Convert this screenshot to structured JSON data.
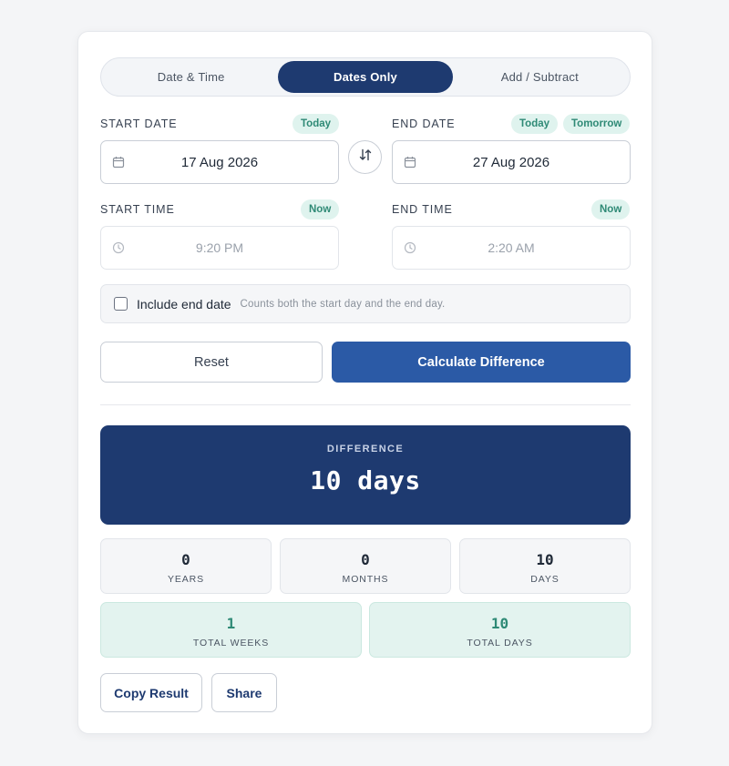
{
  "tabs": [
    {
      "label": "Date & Time",
      "active": false
    },
    {
      "label": "Dates Only",
      "active": true
    },
    {
      "label": "Add / Subtract",
      "active": false
    }
  ],
  "start_date": {
    "label": "START DATE",
    "value": "17 Aug 2026",
    "chip_today": "Today"
  },
  "end_date": {
    "label": "END DATE",
    "value": "27 Aug 2026",
    "chip_today": "Today",
    "chip_tomorrow": "Tomorrow"
  },
  "start_time": {
    "label": "START TIME",
    "value": "9:20 PM",
    "chip_now": "Now"
  },
  "end_time": {
    "label": "END TIME",
    "value": "2:20 AM",
    "chip_now": "Now"
  },
  "include_end": {
    "label": "Include end date",
    "hint": "Counts both the start day and the end day.",
    "checked": false
  },
  "actions": {
    "reset": "Reset",
    "calculate": "Calculate Difference"
  },
  "result": {
    "label": "DIFFERENCE",
    "value": "10 days"
  },
  "breakdown": [
    {
      "value": "0",
      "caption": "YEARS"
    },
    {
      "value": "0",
      "caption": "MONTHS"
    },
    {
      "value": "10",
      "caption": "DAYS"
    }
  ],
  "totals": [
    {
      "value": "1",
      "caption": "TOTAL WEEKS"
    },
    {
      "value": "10",
      "caption": "TOTAL DAYS"
    }
  ],
  "footer": {
    "copy": "Copy Result",
    "share": "Share"
  },
  "colors": {
    "primary": "#1e3a70",
    "accent": "#2b5aa6",
    "teal": "#2f8a76",
    "teal_bg": "#e3f3ef"
  },
  "icons": {
    "date": "calendar-icon",
    "time": "clock-icon",
    "swap": "swap-arrows-icon"
  }
}
